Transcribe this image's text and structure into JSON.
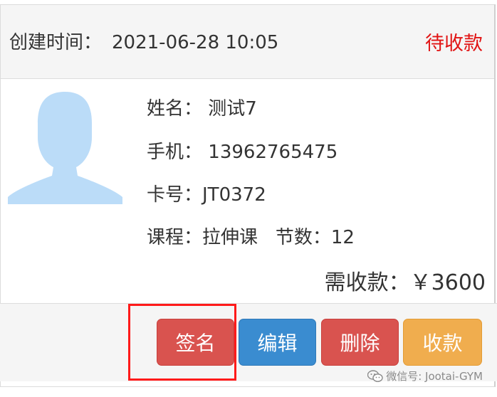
{
  "header": {
    "created_label": "创建时间：",
    "created_value": "2021-06-28 10:05",
    "status": "待收款"
  },
  "member": {
    "avatar_icon": "user-silhouette-icon",
    "name_label": "姓名：",
    "name_value": "测试7",
    "phone_label": "手机：",
    "phone_value": "13962765475",
    "card_label": "卡号：",
    "card_value": "JT0372",
    "course_label": "课程：",
    "course_value": "拉伸课",
    "sessions_label": "节数：",
    "sessions_value": "12"
  },
  "amount": {
    "label": "需收款：",
    "value": "￥3600"
  },
  "actions": {
    "sign": "签名",
    "edit": "编辑",
    "delete": "删除",
    "collect": "收款"
  },
  "watermark": {
    "icon": "wechat-icon",
    "text": "微信号: Jootai-GYM"
  },
  "colors": {
    "status": "#e11414",
    "avatar": "#bbdcf8",
    "sign_button": "#d9534f",
    "edit_button": "#3a8cd0",
    "delete_button": "#d9534f",
    "collect_button": "#f0ad4e",
    "highlight": "#ff1a1a"
  }
}
